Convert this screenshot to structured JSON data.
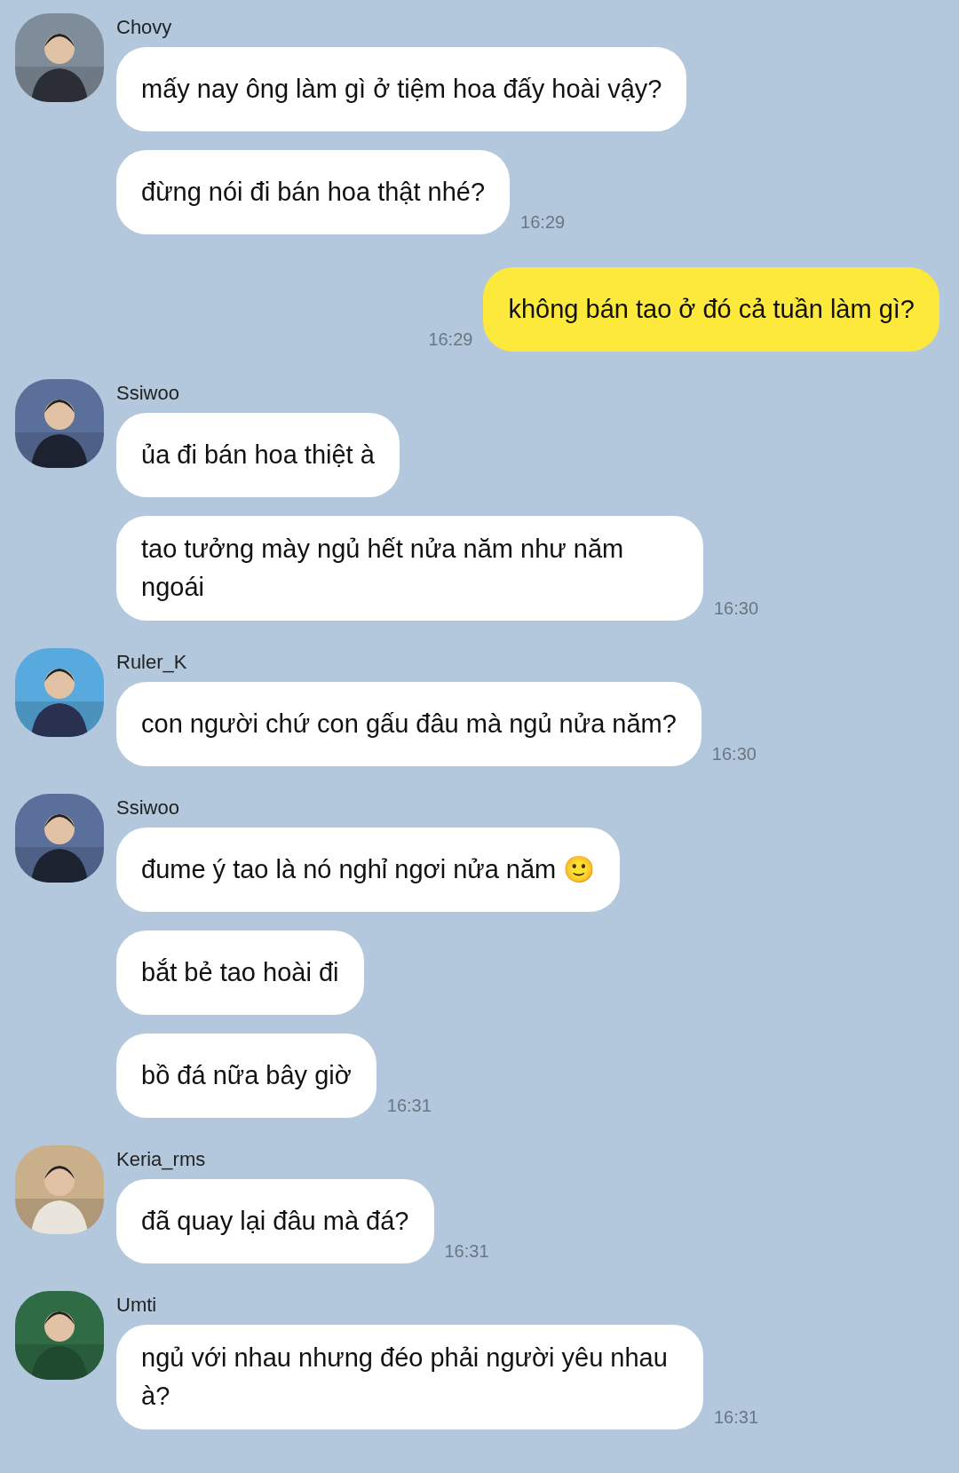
{
  "messages": [
    {
      "kind": "incoming",
      "sender": "Chovy",
      "bubbles": [
        {
          "text": "mấy nay ông làm gì ở tiệm hoa đấy hoài vậy?"
        },
        {
          "text": "đừng nói đi bán hoa thật nhé?",
          "time": "16:29"
        }
      ]
    },
    {
      "kind": "outgoing",
      "bubbles": [
        {
          "text": "không bán tao ở đó cả tuần làm gì?",
          "time": "16:29"
        }
      ]
    },
    {
      "kind": "incoming",
      "sender": "Ssiwoo",
      "bubbles": [
        {
          "text": "ủa đi bán hoa thiệt à"
        },
        {
          "text": "tao tưởng mày ngủ hết nửa năm như năm ngoái",
          "time": "16:30"
        }
      ]
    },
    {
      "kind": "incoming",
      "sender": "Ruler_K",
      "bubbles": [
        {
          "text": "con người chứ con gấu đâu mà ngủ nửa năm?",
          "time": "16:30"
        }
      ]
    },
    {
      "kind": "incoming",
      "sender": "Ssiwoo",
      "bubbles": [
        {
          "text": "đume ý tao là nó nghỉ ngơi nửa năm 🙂"
        },
        {
          "text": "bắt bẻ tao hoài đi"
        },
        {
          "text": "bồ đá nữa bây giờ",
          "time": "16:31"
        }
      ]
    },
    {
      "kind": "incoming",
      "sender": "Keria_rms",
      "bubbles": [
        {
          "text": "đã quay lại đâu mà đá?",
          "time": "16:31"
        }
      ]
    },
    {
      "kind": "incoming",
      "sender": "Umti",
      "bubbles": [
        {
          "text": "ngủ với nhau nhưng đéo phải người yêu nhau à?",
          "time": "16:31"
        }
      ]
    }
  ]
}
